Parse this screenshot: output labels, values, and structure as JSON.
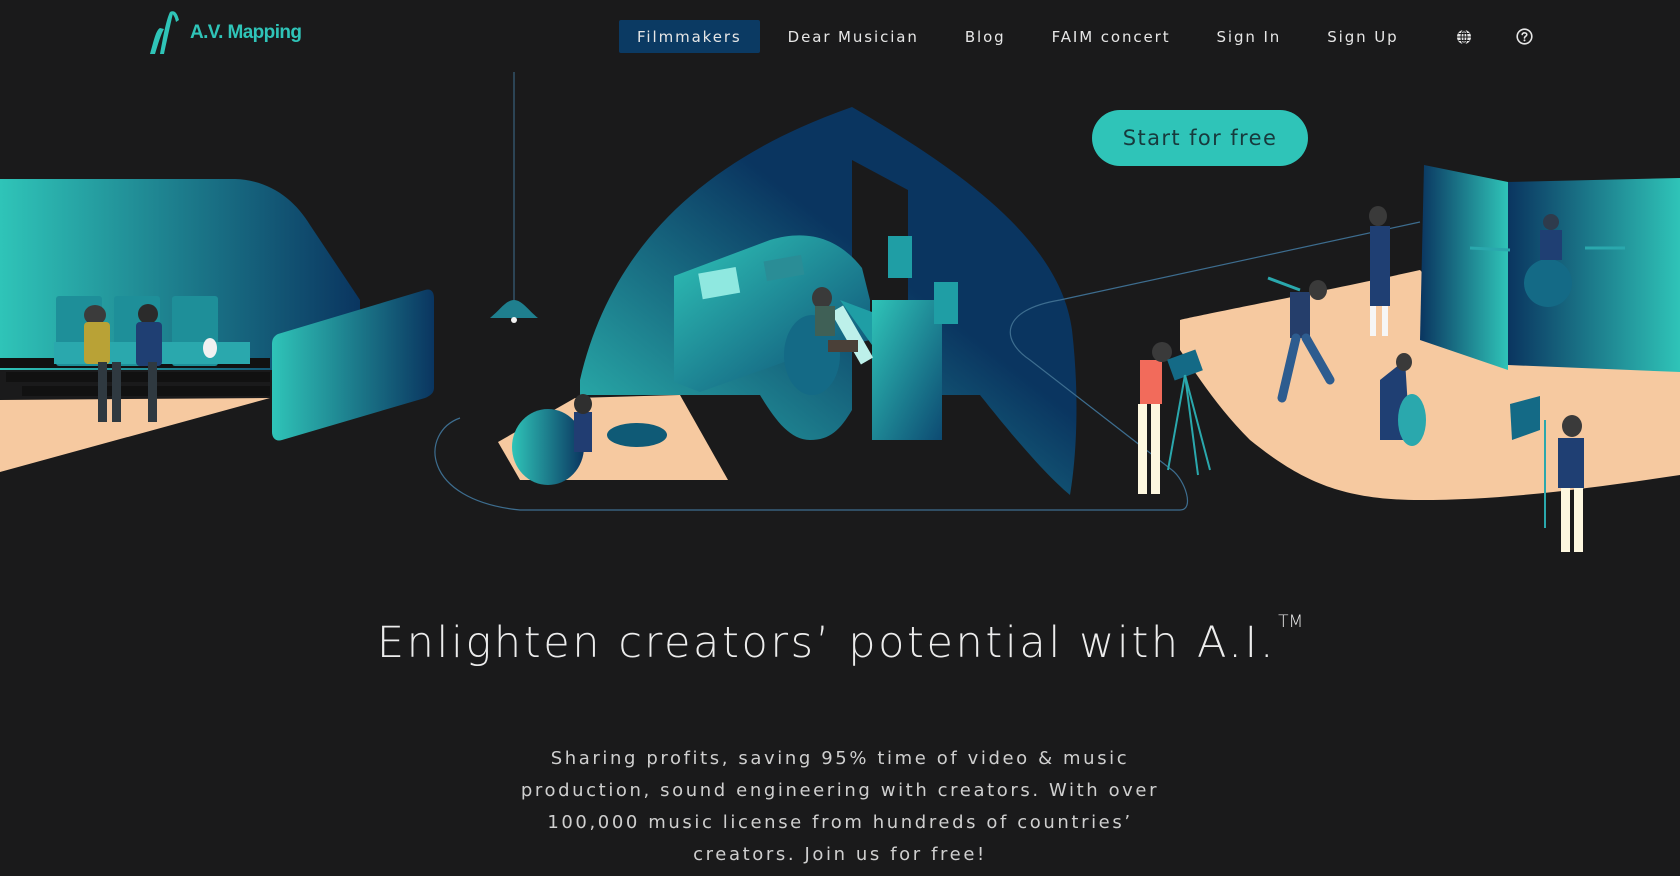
{
  "brand": {
    "name": "A.V. Mapping",
    "logo_icon": "waveform-s-logo-icon",
    "accent_color": "#2fc4b8"
  },
  "nav": {
    "items": [
      {
        "label": "Filmmakers",
        "active": true
      },
      {
        "label": "Dear Musician",
        "active": false
      },
      {
        "label": "Blog",
        "active": false
      },
      {
        "label": "FAIM concert",
        "active": false
      },
      {
        "label": "Sign In",
        "active": false
      },
      {
        "label": "Sign Up",
        "active": false
      }
    ],
    "icons": [
      "globe-icon",
      "help-circle-icon"
    ],
    "active_bg_color": "#0b3a63"
  },
  "hero": {
    "cta_label": "Start for free",
    "illustration": {
      "scenes": [
        "cinema-audience",
        "music-studio",
        "recording-stage"
      ],
      "colors": {
        "teal": "#2fc4b8",
        "navy": "#0b3a63",
        "peach": "#f6c9a0"
      }
    }
  },
  "headline": {
    "text": "Enlighten creators’ potential with A.I.",
    "trademark": "TM"
  },
  "description": {
    "lines": [
      "Sharing profits, saving 95% time of video & music",
      "production, sound engineering with creators. With over",
      "100,000 music license from hundreds of countries’",
      "creators. Join us for free!"
    ]
  }
}
